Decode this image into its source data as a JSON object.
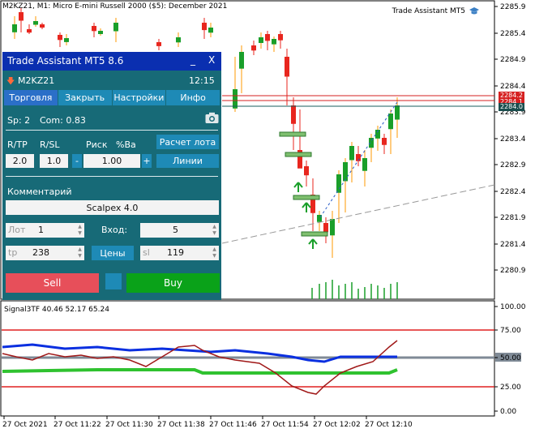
{
  "chart": {
    "title": "M2KZ21, M1:  Micro E-mini Russell 2000 ($5): December 2021",
    "assistant_label": "Trade Assistant MT5",
    "price_axis": [
      "2285.9",
      "2285.4",
      "2284.9",
      "2284.4",
      "2283.9",
      "2283.4",
      "2282.9",
      "2282.4",
      "2281.9",
      "2281.4",
      "2280.9"
    ],
    "price_tags": {
      "top": "2284.2",
      "mid": "2284.1",
      "bottom": "2284.0"
    },
    "time_axis": [
      "27 Oct 2021",
      "27 Oct 11:22",
      "27 Oct 11:30",
      "27 Oct 11:38",
      "27 Oct 11:46",
      "27 Oct 11:54",
      "27 Oct 12:02",
      "27 Oct 12:10"
    ],
    "colors": {
      "bull": "#1a9f2a",
      "bear": "#e8261e",
      "wick_bull": "#ff9800",
      "level_red": "#d62020",
      "level_dark": "#1b5e5e",
      "volume": "#1a9f2a"
    }
  },
  "indicator": {
    "label": "Signal3TF 40.46 52.17 65.24",
    "axis": [
      "100.00",
      "75.00",
      "50.00",
      "25.00",
      "0.00"
    ],
    "highlight": "50.00",
    "colors": {
      "blue": "#0a2fe0",
      "green": "#2fc22f",
      "red": "#a01818",
      "grey": "#7f8a96",
      "level": "#e02020"
    }
  },
  "panel": {
    "title": "Trade Assistant MT5 8.6",
    "minimize": "_",
    "close": "X",
    "symbol": "M2KZ21",
    "time": "12:15",
    "tabs": [
      "Торговля",
      "Закрыть",
      "Настройки",
      "Инфо"
    ],
    "spread": "Sp: 2",
    "commission": "Com: 0.83",
    "rtp_label": "R/TP",
    "rsl_label": "R/SL",
    "risk_label": "Риск",
    "pct_label": "%Ba",
    "calc_button": "Расчет лота",
    "rtp_value": "2.0",
    "rsl_value": "1.0",
    "minus": "-",
    "risk_value": "1.00",
    "plus": "+",
    "lines_button": "Линии",
    "comment_label": "Комментарий",
    "comment_value": "Scalpex 4.0",
    "lot_label": "Лот",
    "lot_value": "1",
    "entry_label": "Вход:",
    "entry_value": "5",
    "tp_label": "tp",
    "tp_value": "238",
    "prices_button": "Цены",
    "sl_label": "sl",
    "sl_value": "119",
    "sell_button": "Sell",
    "buy_button": "Buy"
  }
}
